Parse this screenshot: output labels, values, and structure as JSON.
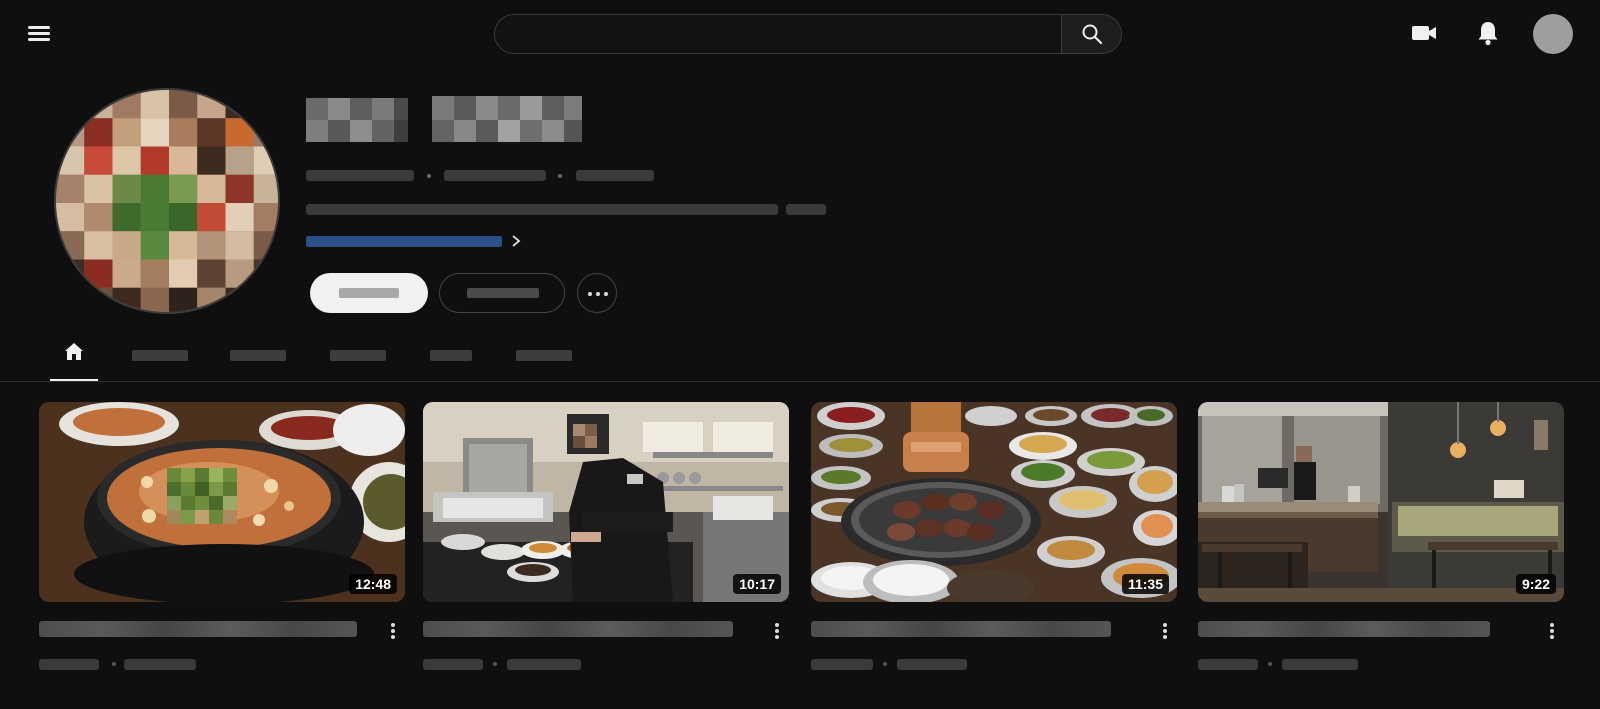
{
  "header": {
    "search": {
      "value": "",
      "placeholder": ""
    },
    "icons": [
      "menu-icon",
      "search-icon",
      "video-camera-icon",
      "bell-icon",
      "account-avatar"
    ]
  },
  "channel": {
    "name": "",
    "handle": "",
    "subscribers": "",
    "video_count": "",
    "description": "",
    "link": "",
    "subscribe_label": "",
    "join_label": "",
    "more_icon": "more-horizontal-icon"
  },
  "tabs": [
    {
      "name": "home",
      "icon": "home-icon",
      "label": ""
    },
    {
      "name": "videos",
      "label": ""
    },
    {
      "name": "shorts",
      "label": ""
    },
    {
      "name": "live",
      "label": ""
    },
    {
      "name": "playlists",
      "label": ""
    },
    {
      "name": "posts",
      "label": ""
    }
  ],
  "videos": [
    {
      "duration": "12:48",
      "title": "",
      "views": "",
      "age": ""
    },
    {
      "duration": "10:17",
      "title": "",
      "views": "",
      "age": ""
    },
    {
      "duration": "11:35",
      "title": "",
      "views": "",
      "age": ""
    },
    {
      "duration": "9:22",
      "title": "",
      "views": "",
      "age": ""
    }
  ],
  "colors": {
    "background": "#0f0f0f",
    "link": "#2b5088",
    "text": "#f1f1f1"
  }
}
